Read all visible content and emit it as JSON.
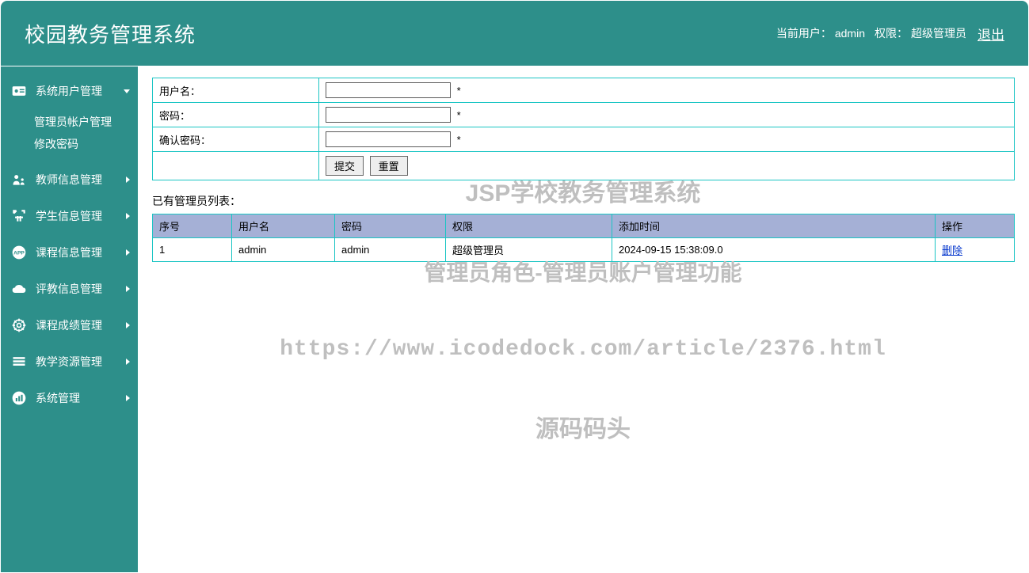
{
  "header": {
    "title": "校园教务管理系统",
    "current_user_label": "当前用户：",
    "current_user": "admin",
    "role_label": "权限：",
    "role": "超级管理员",
    "logout": "退出"
  },
  "sidebar": {
    "items": [
      {
        "label": "系统用户管理",
        "icon": "user-card-icon",
        "expanded": true,
        "submenu": [
          {
            "label": "管理员帐户管理"
          },
          {
            "label": "修改密码"
          }
        ]
      },
      {
        "label": "教师信息管理",
        "icon": "teacher-icon"
      },
      {
        "label": "学生信息管理",
        "icon": "arrows-icon"
      },
      {
        "label": "课程信息管理",
        "icon": "app-icon"
      },
      {
        "label": "评教信息管理",
        "icon": "cloud-icon"
      },
      {
        "label": "课程成绩管理",
        "icon": "gear-icon"
      },
      {
        "label": "教学资源管理",
        "icon": "stack-icon"
      },
      {
        "label": "系统管理",
        "icon": "chart-icon"
      }
    ]
  },
  "form": {
    "username_label": "用户名：",
    "password_label": "密码：",
    "confirm_label": "确认密码：",
    "asterisk": "*",
    "submit": "提交",
    "reset": "重置"
  },
  "list": {
    "title": "已有管理员列表：",
    "headers": {
      "seq": "序号",
      "username": "用户名",
      "password": "密码",
      "role": "权限",
      "add_time": "添加时间",
      "action": "操作"
    },
    "rows": [
      {
        "seq": "1",
        "username": "admin",
        "password": "admin",
        "role": "超级管理员",
        "add_time": "2024-09-15 15:38:09.0",
        "action": "删除"
      }
    ]
  },
  "watermarks": {
    "line1": "JSP学校教务管理系统",
    "line2": "管理员角色-管理员账户管理功能",
    "line3": "https://www.icodedock.com/article/2376.html",
    "line4": "源码码头"
  }
}
